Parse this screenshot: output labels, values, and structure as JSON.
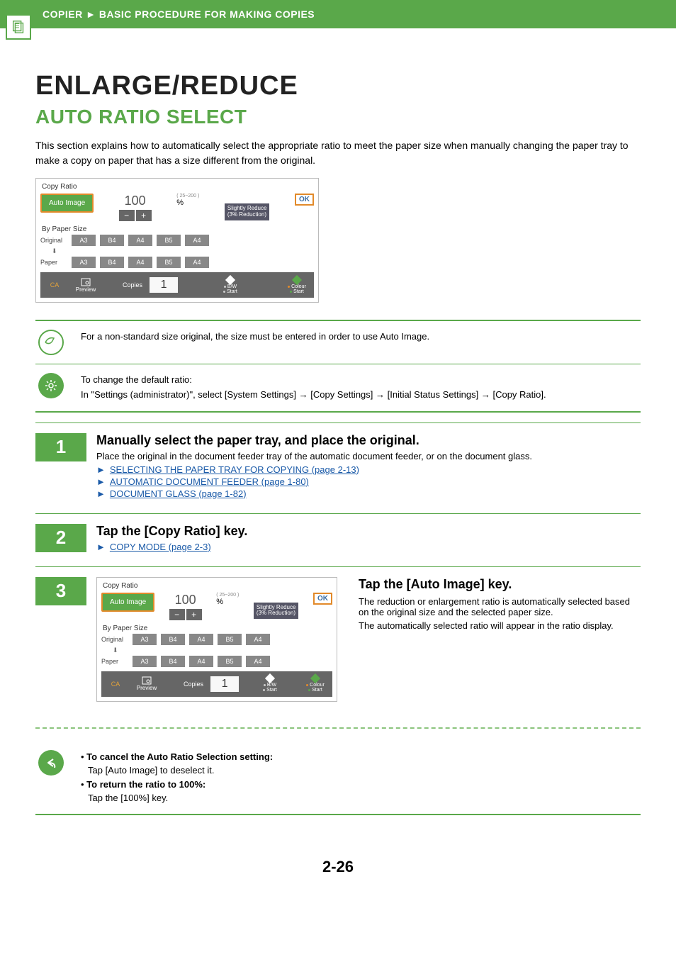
{
  "header": {
    "section": "COPIER",
    "separator": "►",
    "subsection": "BASIC PROCEDURE FOR MAKING COPIES"
  },
  "title": "ENLARGE/REDUCE",
  "subtitle": "AUTO RATIO SELECT",
  "intro": "This section explains how to automatically select the appropriate ratio to meet the paper size when manually changing the paper tray to make a copy on paper that has a size different from the original.",
  "panel": {
    "title": "Copy Ratio",
    "auto_image": "Auto Image",
    "ratio_value": "100",
    "minus": "−",
    "plus": "+",
    "range": "( 25~200 )",
    "percent": "%",
    "slightly_l1": "Slightly Reduce",
    "slightly_l2": "(3% Reduction)",
    "ok": "OK",
    "by_paper": "By Paper Size",
    "row_original": "Original",
    "row_paper": "Paper",
    "sizes": [
      "A3",
      "B4",
      "A4",
      "B5",
      "A4"
    ],
    "ca": "CA",
    "preview": "Preview",
    "copies_label": "Copies",
    "copies_value": "1",
    "bw_l1": "B/W",
    "bw_l2": "Start",
    "colour_l1": "Colour",
    "colour_l2": "Start"
  },
  "note1": "For a non-standard size original, the size must be entered in order to use Auto Image.",
  "note2_l1": "To change the default ratio:",
  "note2_l2": "In \"Settings (administrator)\", select [System Settings] → [Copy Settings] → [Initial Status Settings] → [Copy Ratio].",
  "step1": {
    "num": "1",
    "title": "Manually select the paper tray, and place the original.",
    "desc": "Place the original in the document feeder tray of the automatic document feeder, or on the document glass.",
    "links": [
      "SELECTING THE PAPER TRAY FOR COPYING (page 2-13)",
      "AUTOMATIC DOCUMENT FEEDER (page 1-80)",
      "DOCUMENT GLASS (page 1-82)"
    ]
  },
  "step2": {
    "num": "2",
    "title": "Tap the [Copy Ratio] key.",
    "links": [
      "COPY MODE (page 2-3)"
    ]
  },
  "step3": {
    "num": "3",
    "title": "Tap the [Auto Image] key.",
    "desc1": "The reduction or enlargement ratio is automatically selected based on the original size and the selected paper size.",
    "desc2": "The automatically selected ratio will appear in the ratio display."
  },
  "tips": {
    "b1_title": "To cancel the Auto Ratio Selection setting:",
    "b1_body": "Tap [Auto Image] to deselect it.",
    "b2_title": "To return the ratio to 100%:",
    "b2_body": "Tap the [100%] key."
  },
  "page_num": "2-26"
}
